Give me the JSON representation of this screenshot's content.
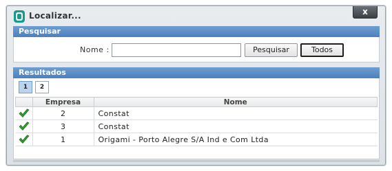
{
  "window": {
    "title": "Localizar...",
    "close_label": "x"
  },
  "search": {
    "section_title": "Pesquisar",
    "nome_label": "Nome :",
    "input_value": "",
    "pesquisar_label": "Pesquisar",
    "todos_label": "Todos"
  },
  "results": {
    "section_title": "Resultados",
    "pages": [
      "1",
      "2"
    ],
    "active_page": "1",
    "columns": [
      "",
      "Empresa",
      "Nome"
    ],
    "rows": [
      {
        "empresa": "2",
        "nome": "Constat"
      },
      {
        "empresa": "3",
        "nome": "Constat"
      },
      {
        "empresa": "1",
        "nome": "Origami - Porto Alegre S/A Ind e Com Ltda"
      }
    ]
  },
  "colors": {
    "header_blue": "#4b7fbf",
    "check_green": "#2e9b2e",
    "app_icon": "#1a9a8e"
  },
  "icons": {
    "app": "app-logo-icon",
    "close": "close-icon",
    "row_status": "checkmark-icon"
  }
}
